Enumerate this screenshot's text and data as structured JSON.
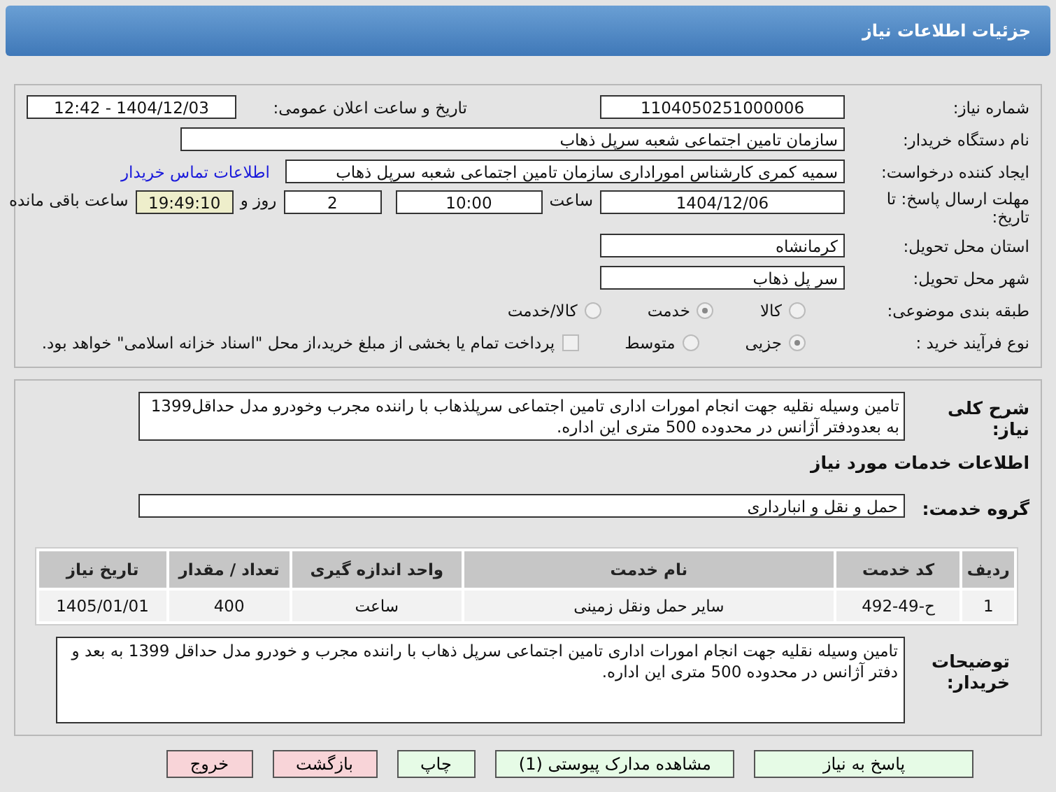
{
  "header": {
    "title": "جزئیات اطلاعات نیاز"
  },
  "need_number": {
    "label": "شماره نیاز:",
    "value": "1104050251000006"
  },
  "announce": {
    "label": "تاریخ و ساعت اعلان عمومی:",
    "value": "1404/12/03 - 12:42"
  },
  "buyer_org": {
    "label": "نام دستگاه خریدار:",
    "value": "سازمان تامین اجتماعی شعبه سرپل ذهاب"
  },
  "requester": {
    "label": "ایجاد کننده درخواست:",
    "value": "سمیه کمری کارشناس اموراداری سازمان تامین اجتماعی شعبه سرپل ذهاب",
    "link": "اطلاعات تماس خریدار"
  },
  "deadline": {
    "label": "مهلت ارسال پاسخ: تا تاریخ:",
    "date": "1404/12/06",
    "time_label": "ساعت",
    "time": "10:00",
    "days": "2",
    "days_label": "روز و",
    "remaining": "19:49:10",
    "remaining_label": "ساعت باقی مانده"
  },
  "province": {
    "label": "استان محل تحویل:",
    "value": "کرمانشاه"
  },
  "city": {
    "label": "شهر محل تحویل:",
    "value": "سر پل ذهاب"
  },
  "category": {
    "label": "طبقه بندی موضوعی:",
    "options": [
      {
        "label": "کالا",
        "selected": false
      },
      {
        "label": "خدمت",
        "selected": true
      },
      {
        "label": "کالا/خدمت",
        "selected": false
      }
    ]
  },
  "process": {
    "label": "نوع فرآیند خرید :",
    "options": [
      {
        "label": "جزیی",
        "selected": true
      },
      {
        "label": "متوسط",
        "selected": false
      }
    ],
    "payment": {
      "checked": false,
      "text": "پرداخت تمام یا بخشی از مبلغ خرید،از محل \"اسناد خزانه اسلامی\" خواهد بود."
    }
  },
  "description": {
    "label": "شرح کلی نیاز:",
    "value": "تامین وسیله نقلیه جهت انجام امورات اداری تامین اجتماعی سرپلذهاب با راننده مجرب وخودرو مدل حداقل1399 به بعدودفتر آژانس در محدوده 500 متری این اداره."
  },
  "services_title": "اطلاعات خدمات مورد نیاز",
  "service_group": {
    "label": "گروه خدمت:",
    "value": "حمل و نقل و انبارداری"
  },
  "table": {
    "columns": [
      "ردیف",
      "کد خدمت",
      "نام خدمت",
      "واحد اندازه گیری",
      "تعداد / مقدار",
      "تاریخ نیاز"
    ],
    "rows": [
      [
        "1",
        "ح-49-492",
        "سایر حمل ونقل زمینی",
        "ساعت",
        "400",
        "1405/01/01"
      ]
    ]
  },
  "buyer_notes": {
    "label": "توضیحات خریدار:",
    "value": "تامین وسیله نقلیه جهت انجام امورات اداری تامین اجتماعی سرپل ذهاب با راننده مجرب و خودرو مدل حداقل 1399 به بعد و دفتر آژانس در محدوده 500 متری این اداره."
  },
  "buttons": [
    {
      "label": "پاسخ به نیاز",
      "kind": "primary"
    },
    {
      "label": "مشاهده مدارک پیوستی (1)",
      "kind": "primary"
    },
    {
      "label": "چاپ",
      "kind": "primary"
    },
    {
      "label": "بازگشت",
      "kind": "danger"
    },
    {
      "label": "خروج",
      "kind": "danger"
    }
  ]
}
